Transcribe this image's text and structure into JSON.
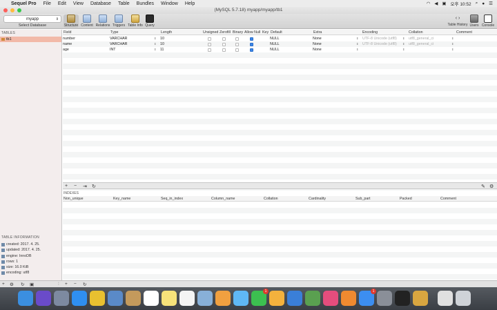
{
  "menubar": {
    "apple": "",
    "app_name": "Sequel Pro",
    "items": [
      "File",
      "Edit",
      "View",
      "Database",
      "Table",
      "Bundles",
      "Window",
      "Help"
    ],
    "clock": "오후 10:52"
  },
  "window": {
    "title": "(MySQL 5.7.18) myapp/myapp/tb1"
  },
  "toolbar": {
    "database_value": "myapp",
    "database_label": "Select Database",
    "buttons": [
      "Structure",
      "Content",
      "Relations",
      "Triggers",
      "Table Info",
      "Query"
    ],
    "right_buttons": [
      "Table History",
      "Users",
      "Console"
    ]
  },
  "sidebar": {
    "tables_heading": "TABLES",
    "tables": [
      "tb1"
    ],
    "info_heading": "TABLE INFORMATION",
    "info": [
      "created: 2017. 4. 25.",
      "updated: 2017. 4. 25.",
      "engine: InnoDB",
      "rows: 1",
      "size: 16.0 KiB",
      "encoding: utf8"
    ]
  },
  "structure": {
    "columns": [
      "Field",
      "Type",
      "Length",
      "Unsigned",
      "Zerofill",
      "Binary",
      "Allow Null",
      "Key",
      "Default",
      "Extra",
      "Encoding",
      "Collation",
      "Comment"
    ],
    "rows": [
      {
        "field": "number",
        "type": "VARCHAR",
        "length": "10",
        "unsigned": false,
        "zerofill": false,
        "binary": false,
        "allow_null": true,
        "key": "",
        "default": "NULL",
        "extra": "None",
        "encoding": "UTF-8 Unicode (utf8)",
        "collation": "utf8_general_ci"
      },
      {
        "field": "name",
        "type": "VARCHAR",
        "length": "10",
        "unsigned": false,
        "zerofill": false,
        "binary": false,
        "allow_null": true,
        "key": "",
        "default": "NULL",
        "extra": "None",
        "encoding": "UTF-8 Unicode (utf8)",
        "collation": "utf8_general_ci"
      },
      {
        "field": "age",
        "type": "INT",
        "length": "11",
        "unsigned": false,
        "zerofill": false,
        "binary": false,
        "allow_null": true,
        "key": "",
        "default": "NULL",
        "extra": "None",
        "encoding": "",
        "collation": ""
      }
    ]
  },
  "indexes": {
    "heading": "INDEXES",
    "columns": [
      "Non_unique",
      "Key_name",
      "Seq_in_index",
      "Column_name",
      "Collation",
      "Cardinality",
      "Sub_part",
      "Packed",
      "Comment"
    ]
  },
  "controls": {
    "add": "+",
    "remove": "−",
    "duplicate": "⇥",
    "refresh": "↻"
  },
  "dock": {
    "badges": [
      "1",
      "1"
    ]
  },
  "colors": {
    "selected_table": "#f2b9a8",
    "sidebar_bg": "#f3eded",
    "checkbox_on": "#3c86e8"
  }
}
